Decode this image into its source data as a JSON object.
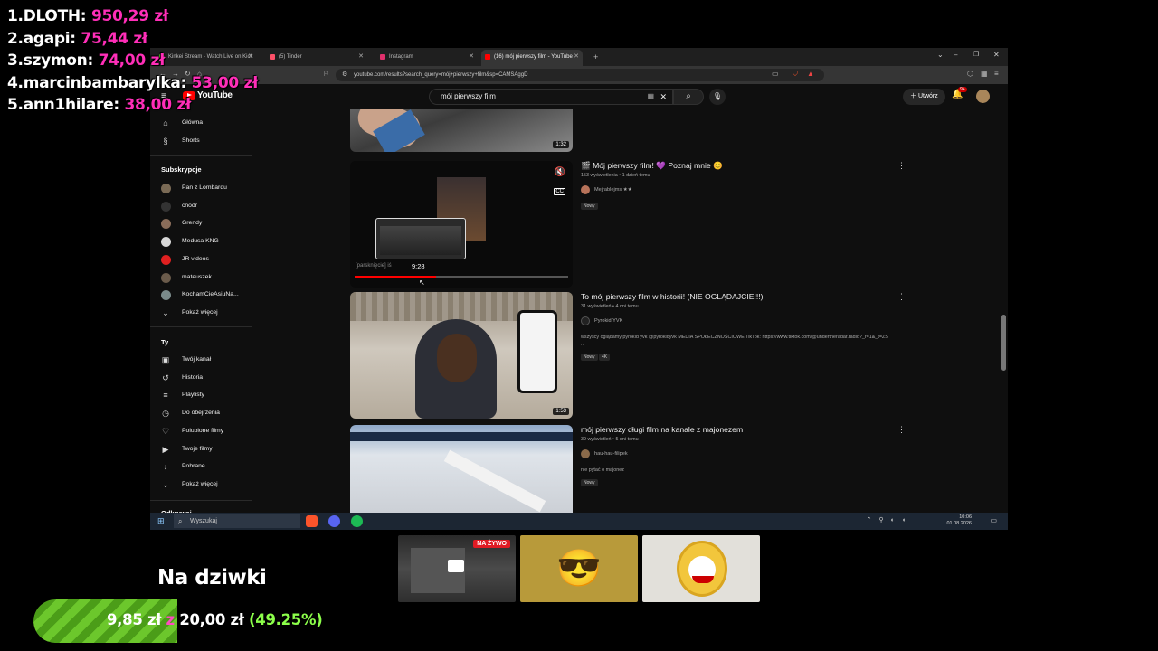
{
  "leaderboard": [
    {
      "rank": "1.",
      "name": "DLOTH:",
      "amount": "950,29 zł"
    },
    {
      "rank": "2.",
      "name": "agapi:",
      "amount": "75,44 zł"
    },
    {
      "rank": "3.",
      "name": "szymon:",
      "amount": "74,00 zł"
    },
    {
      "rank": "4.",
      "name": "marcinbambarylka:",
      "amount": "53,00 zł"
    },
    {
      "rank": "5.",
      "name": "ann1hilare:",
      "amount": "38,00 zł"
    }
  ],
  "browser": {
    "tabs": [
      {
        "label": "Kinkei Stream - Watch Live on Kick",
        "color": "#53fc18"
      },
      {
        "label": "(5) Tinder",
        "color": "#fd5068"
      },
      {
        "label": "Instagram",
        "color": "#e1306c"
      },
      {
        "label": "(16) mój pierwszy film - YouTube",
        "color": "#ff0000"
      }
    ],
    "new_tab": "+",
    "url": "youtube.com/results?search_query=mój+pierwszy+film&sp=CAMSAggD"
  },
  "youtube": {
    "logo": "YouTube",
    "search_query": "mój pierwszy film",
    "create_label": "Utwórz",
    "notifications": "9+"
  },
  "sidebar": {
    "top": [
      {
        "label": "Główna",
        "icon": "home-icon",
        "glyph": "⌂"
      },
      {
        "label": "Shorts",
        "icon": "shorts-icon",
        "glyph": "§"
      }
    ],
    "subs_heading": "Subskrypcje",
    "subs": [
      {
        "label": "Pan z Lombardu",
        "color": "#7a6a55"
      },
      {
        "label": "cnodr",
        "color": "#333"
      },
      {
        "label": "Grendy",
        "color": "#8a6d5a"
      },
      {
        "label": "Medusa KNG",
        "color": "#d8d8d8"
      },
      {
        "label": "JR videos",
        "color": "#e02020"
      },
      {
        "label": "mateuszek",
        "color": "#6b5b4b"
      },
      {
        "label": "KochamCieAsiuNa...",
        "color": "#7a8a8a"
      }
    ],
    "show_more": "Pokaż więcej",
    "you_heading": "Ty",
    "you": [
      {
        "label": "Twój kanał",
        "icon": "channel-icon",
        "glyph": "▣"
      },
      {
        "label": "Historia",
        "icon": "history-icon",
        "glyph": "↺"
      },
      {
        "label": "Playlisty",
        "icon": "playlist-icon",
        "glyph": "≡"
      },
      {
        "label": "Do obejrzenia",
        "icon": "clock-icon",
        "glyph": "◷"
      },
      {
        "label": "Polubione filmy",
        "icon": "like-icon",
        "glyph": "♡"
      },
      {
        "label": "Twoje filmy",
        "icon": "video-icon",
        "glyph": "▶"
      },
      {
        "label": "Pobrane",
        "icon": "download-icon",
        "glyph": "↓"
      }
    ],
    "show_more2": "Pokaż więcej",
    "cut_heading": "Odkrywaj"
  },
  "results": [
    {
      "duration": "1:32"
    },
    {
      "title": "Mój pierwszy film! 💜 Poznaj mnie 😊",
      "prefix": "🎬",
      "meta": "153 wyświetlenia • 1 dzień temu",
      "channel": "Mejrablejms ★★",
      "badge": "Nowy",
      "preview_time": "9:28",
      "preview_caption": "[parsknięcie] iś",
      "progress": 0.38
    },
    {
      "title": "To mój pierwszy film w historii! (NIE OGLĄDAJCIE!!!)",
      "meta": "31 wyświetleń • 4 dni temu",
      "channel": "Pyrokid YVK",
      "desc": "wszyscy oglądamy pyrokid yvk @pyrokidyvk MEDIA SPOŁECZNOŚCIOWE TikTok: https://www.tiktok.com/@undertheradar.radio?_r=1&_t=ZS ...",
      "badges": [
        "Nowy",
        "4K"
      ],
      "duration": "1:53"
    },
    {
      "title": "mój pierwszy długi film na kanale z majonezem",
      "meta": "39 wyświetleń • 5 dni temu",
      "channel": "hau-hau-filipek",
      "desc": "nie pytać o majonez",
      "badge": "Nowy"
    }
  ],
  "taskbar": {
    "search": "Wyszukaj",
    "time": "10:06",
    "date": "01.08.2026"
  },
  "overlay": {
    "live_badge": "NA ŻYWO",
    "goal_title": "Na dziwki",
    "goal_current": "9,85 zł",
    "goal_sep": "z",
    "goal_target": "20,00 zł",
    "goal_percent": "(49.25%)",
    "goal_fraction": 0.4925
  },
  "colors": {
    "amount": "#ff2eb8",
    "goal_green": "#6cc72c",
    "yt_red": "#ff0000"
  }
}
